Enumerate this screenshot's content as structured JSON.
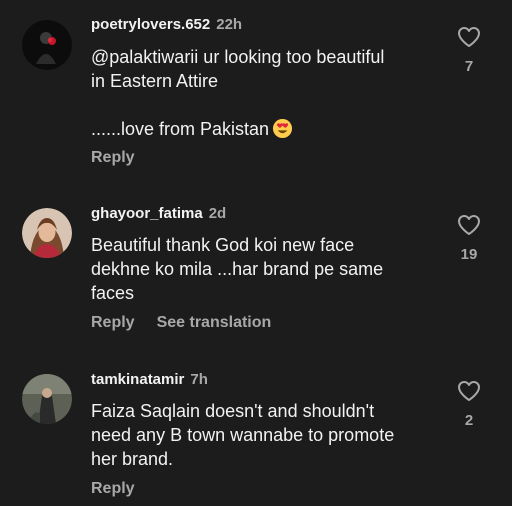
{
  "colors": {
    "background": "#1c1c1c",
    "primary_text": "#f2f2f2",
    "secondary_text": "#a8a8a8"
  },
  "comments": [
    {
      "username": "poetrylovers.652",
      "time": "22h",
      "lines": [
        "@palaktiwarii  ur looking too beautiful",
        "in Eastern Attire",
        "",
        "......love from Pakistan"
      ],
      "emoji": "smiling-face-with-heart-eyes",
      "reply_label": "Reply",
      "like_icon": "heart-outline-icon",
      "like_count": "7"
    },
    {
      "username": "ghayoor_fatima",
      "time": "2d",
      "lines": [
        "Beautiful thank God koi new face",
        "dekhne ko mila ...har brand pe same",
        "faces"
      ],
      "reply_label": "Reply",
      "translation_label": "See translation",
      "like_icon": "heart-outline-icon",
      "like_count": "19"
    },
    {
      "username": "tamkinatamir",
      "time": "7h",
      "lines": [
        "Faiza Saqlain doesn't and shouldn't",
        "need any B town wannabe to promote",
        "her brand."
      ],
      "reply_label": "Reply",
      "like_icon": "heart-outline-icon",
      "like_count": "2"
    }
  ]
}
